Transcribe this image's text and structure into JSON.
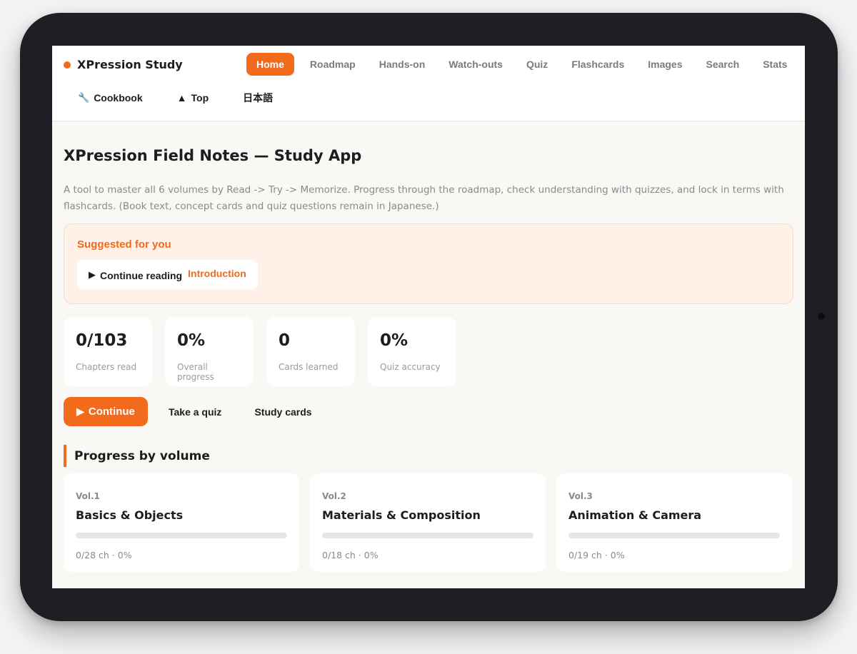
{
  "app": {
    "brand_title": "XPression Study",
    "accent_color": "#f26a1b"
  },
  "nav": {
    "items": [
      {
        "label": "Home",
        "active": true
      },
      {
        "label": "Roadmap"
      },
      {
        "label": "Hands-on"
      },
      {
        "label": "Watch-outs"
      },
      {
        "label": "Quiz"
      },
      {
        "label": "Flashcards"
      },
      {
        "label": "Images"
      },
      {
        "label": "Search"
      },
      {
        "label": "Stats"
      }
    ],
    "secondary": [
      {
        "icon": "wrench-icon",
        "glyph": "🔧",
        "label": "Cookbook"
      },
      {
        "icon": "triangle-up-icon",
        "glyph": "▲",
        "label": "Top"
      },
      {
        "label": "日本語"
      }
    ]
  },
  "main": {
    "title": "XPression Field Notes — Study App",
    "description": "A tool to master all 6 volumes by Read -> Try -> Memorize. Progress through the roadmap, check understanding with quizzes, and lock in terms with flashcards. (Book text, concept cards and quiz questions remain in Japanese.)",
    "suggestion": {
      "title": "Suggested for you",
      "action_label": "Continue reading",
      "chapter": "Introduction"
    },
    "stats": [
      {
        "value": "0/103",
        "label": "Chapters read"
      },
      {
        "value": "0%",
        "label": "Overall progress"
      },
      {
        "value": "0",
        "label": "Cards learned"
      },
      {
        "value": "0%",
        "label": "Quiz accuracy"
      }
    ],
    "actions": {
      "primary": "Continue",
      "quiz": "Take a quiz",
      "cards": "Study cards"
    },
    "progress_section_title": "Progress by volume",
    "volumes": [
      {
        "num": "Vol.1",
        "title": "Basics & Objects",
        "meta": "0/28 ch · 0%",
        "progress": 0
      },
      {
        "num": "Vol.2",
        "title": "Materials & Composition",
        "meta": "0/18 ch · 0%",
        "progress": 0
      },
      {
        "num": "Vol.3",
        "title": "Animation & Camera",
        "meta": "0/19 ch · 0%",
        "progress": 0
      }
    ]
  }
}
